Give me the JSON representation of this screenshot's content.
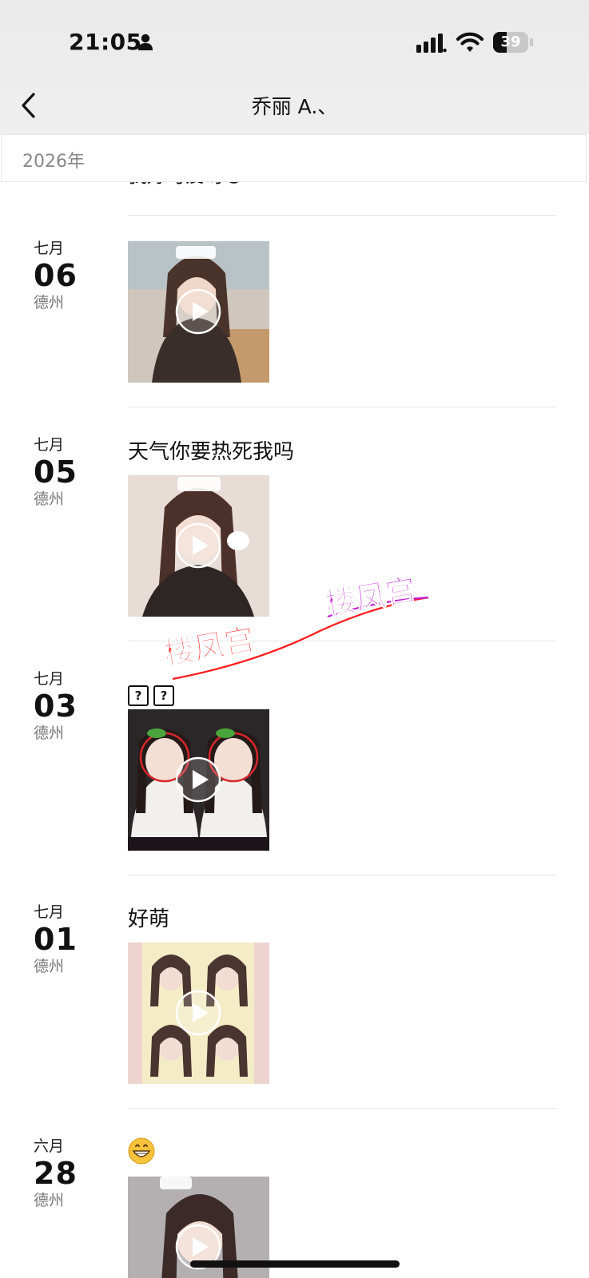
{
  "status_bar": {
    "time": "21:05",
    "battery_level": "39",
    "battery_fraction": 0.39
  },
  "nav": {
    "title": "乔丽 A.、"
  },
  "year_section": {
    "label": "2026年"
  },
  "cut_post": {
    "text": "我好可爱呀😄"
  },
  "posts": [
    {
      "month": "七月",
      "day": "06",
      "location": "德州",
      "text": "",
      "media": "video"
    },
    {
      "month": "七月",
      "day": "05",
      "location": "德州",
      "text": "天气你要热死我吗",
      "media": "video"
    },
    {
      "month": "七月",
      "day": "03",
      "location": "德州",
      "text": "??",
      "media": "video"
    },
    {
      "month": "七月",
      "day": "01",
      "location": "德州",
      "text": "好萌",
      "media": "video"
    },
    {
      "month": "六月",
      "day": "28",
      "location": "德州",
      "text": "",
      "media": "video"
    }
  ],
  "watermark": {
    "text_1": "楼凤宫",
    "text_2": "楼凤宫"
  },
  "icons": {
    "back": "chevron-left-icon",
    "person": "person-icon",
    "signal": "signal-icon",
    "wifi": "wifi-icon",
    "battery": "battery-icon",
    "play": "play-icon",
    "emoji": "grinning-face-icon"
  },
  "colors": {
    "background": "#ffffff",
    "header": "#ececec",
    "divider": "#e5e5e5",
    "watermark_red": "#ff1a1a",
    "watermark_purple": "#c21bd9"
  }
}
